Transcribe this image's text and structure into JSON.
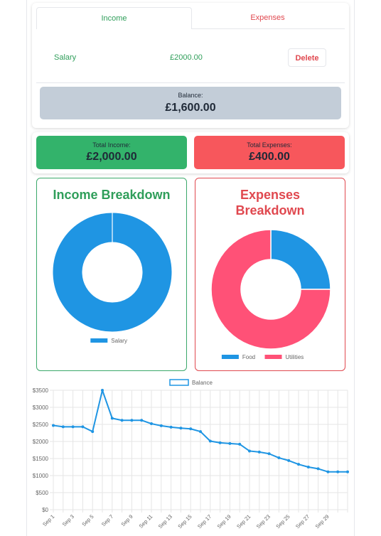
{
  "tabs": {
    "income": "Income",
    "expenses": "Expenses"
  },
  "entry": {
    "name": "Salary",
    "amount": "£2000.00",
    "delete_label": "Delete"
  },
  "balance": {
    "label": "Balance:",
    "value": "£1,600.00"
  },
  "totals": {
    "income_label": "Total Income:",
    "income_value": "£2,000.00",
    "expenses_label": "Total Expenses:",
    "expenses_value": "£400.00"
  },
  "colors": {
    "income": "#2f9e5a",
    "expense": "#e0484f",
    "blue": "#1f95e3",
    "pink": "#ff5177"
  },
  "chart_data": [
    {
      "type": "pie",
      "title": "Income Breakdown",
      "categories": [
        "Salary"
      ],
      "values": [
        2000
      ],
      "colors": [
        "#1f95e3"
      ],
      "legend_placement": "bottom"
    },
    {
      "type": "pie",
      "title": "Expenses Breakdown",
      "categories": [
        "Food",
        "Utilities"
      ],
      "values": [
        100,
        300
      ],
      "colors": [
        "#1f95e3",
        "#ff5177"
      ],
      "legend_placement": "bottom"
    },
    {
      "type": "line",
      "series": [
        {
          "name": "Balance",
          "values": [
            2470,
            2430,
            2430,
            2430,
            2290,
            3500,
            2680,
            2620,
            2620,
            2620,
            2520,
            2460,
            2420,
            2390,
            2370,
            2290,
            2010,
            1960,
            1940,
            1920,
            1720,
            1690,
            1640,
            1520,
            1440,
            1330,
            1250,
            1200,
            1110,
            1110,
            1110
          ]
        }
      ],
      "x_ticks": [
        "Sep 1",
        "Sep 3",
        "Sep 5",
        "Sep 7",
        "Sep 9",
        "Sep 11",
        "Sep 13",
        "Sep 15",
        "Sep 17",
        "Sep 19",
        "Sep 21",
        "Sep 23",
        "Sep 25",
        "Sep 27",
        "Sep 29"
      ],
      "y_ticks": [
        "$0",
        "$500",
        "$1000",
        "$1500",
        "$2000",
        "$2500",
        "$3000",
        "$3500"
      ],
      "ylim": [
        0,
        3500
      ],
      "grid": true,
      "legend_placement": "top"
    }
  ]
}
